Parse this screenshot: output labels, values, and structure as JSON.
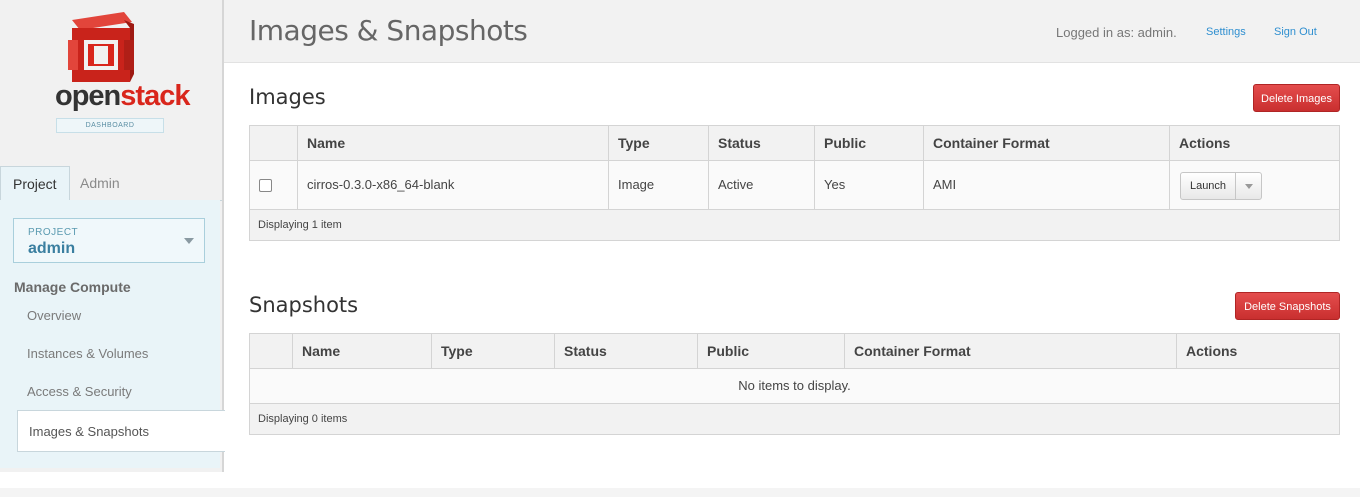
{
  "brand": {
    "name_part1": "open",
    "name_part2": "stack",
    "tagline": "DASHBOARD",
    "colors": {
      "red": "#d9261c",
      "dark": "#333333"
    }
  },
  "tabs": [
    {
      "label": "Project"
    },
    {
      "label": "Admin"
    }
  ],
  "project_selector": {
    "label": "PROJECT",
    "value": "admin"
  },
  "nav": {
    "heading": "Manage Compute",
    "items": [
      {
        "label": "Overview"
      },
      {
        "label": "Instances & Volumes"
      },
      {
        "label": "Access & Security"
      },
      {
        "label": "Images & Snapshots"
      }
    ]
  },
  "header": {
    "title": "Images & Snapshots",
    "logged_in": "Logged in as: admin.",
    "settings": "Settings",
    "sign_out": "Sign Out"
  },
  "images": {
    "title": "Images",
    "delete_button": "Delete Images",
    "columns": [
      "Name",
      "Type",
      "Status",
      "Public",
      "Container Format",
      "Actions"
    ],
    "rows": [
      {
        "name": "cirros-0.3.0-x86_64-blank",
        "type": "Image",
        "status": "Active",
        "public": "Yes",
        "format": "AMI",
        "action": "Launch"
      }
    ],
    "footer": "Displaying 1 item"
  },
  "snapshots": {
    "title": "Snapshots",
    "delete_button": "Delete Snapshots",
    "columns": [
      "Name",
      "Type",
      "Status",
      "Public",
      "Container Format",
      "Actions"
    ],
    "empty": "No items to display.",
    "footer": "Displaying 0 items"
  }
}
